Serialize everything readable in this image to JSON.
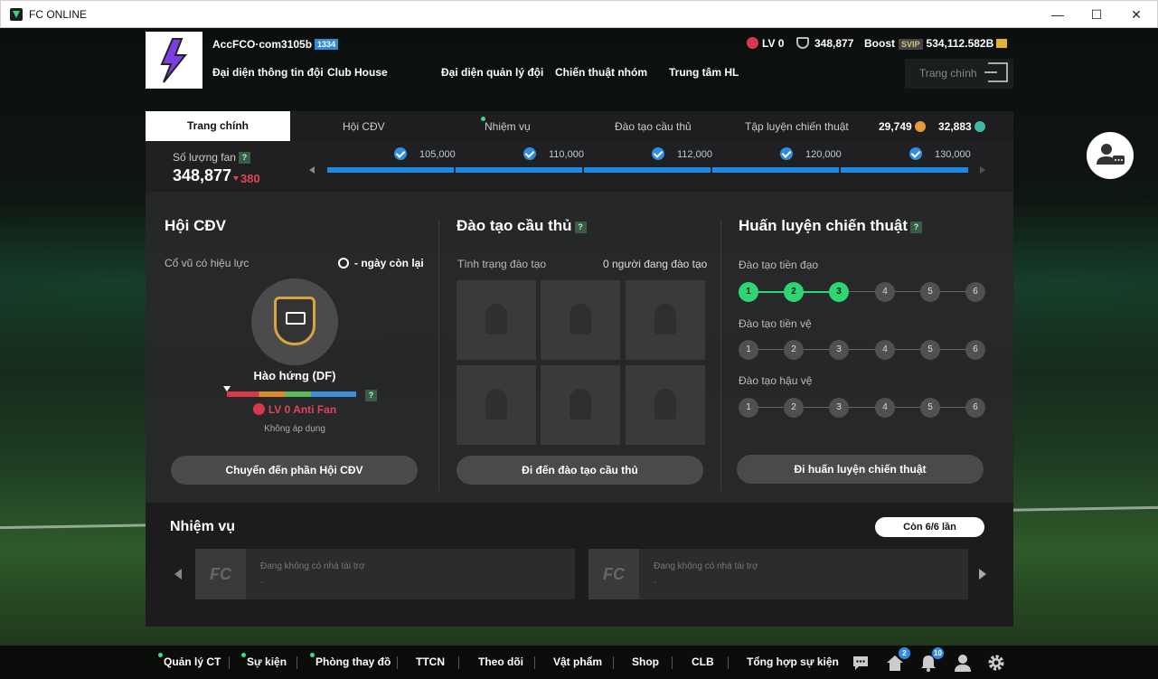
{
  "window": {
    "title": "FC ONLINE"
  },
  "header": {
    "username": "AccFCO·com3105b",
    "user_badge": "1334",
    "nav": [
      "Đại diện thông tin đội",
      "Club House",
      "Đại diện quản lý đội",
      "Chiến thuật nhóm",
      "Trung tâm HL"
    ],
    "level": "LV 0",
    "fans": "348,877",
    "boost_label": "Boost",
    "svip": "SVIP",
    "bp": "534,112.582B",
    "home_label": "Trang chính"
  },
  "tabs": {
    "active": "Trang chính",
    "items": [
      "Hội CĐV",
      "Nhiệm vụ",
      "Đào tạo cầu thủ",
      "Tập luyện chiến thuật"
    ],
    "coin1": "29,749",
    "coin2": "32,883"
  },
  "fan": {
    "label": "Số lượng fan",
    "count": "348,877",
    "delta": "380",
    "milestones": [
      "105,000",
      "110,000",
      "112,000",
      "120,000",
      "130,000"
    ]
  },
  "fanclub": {
    "title": "Hội CĐV",
    "effect_label": "Cổ vũ có hiệu lực",
    "days_left": "- ngày còn lại",
    "mood": "Hào hứng (DF)",
    "antifan": "LV 0 Anti Fan",
    "not_applied": "Không áp dụng",
    "button": "Chuyển đến phần Hội CĐV"
  },
  "training": {
    "title": "Đào tạo cầu thủ",
    "status_label": "Tình trạng đào tạo",
    "status_value": "0 người đang đào tạo",
    "button": "Đi đến đào tạo cầu thủ"
  },
  "tactics": {
    "title": "Huấn luyện chiến thuật",
    "rows": [
      {
        "label": "Đào tạo tiền đạo",
        "unlocked": 3
      },
      {
        "label": "Đào tạo tiền vệ",
        "unlocked": 0
      },
      {
        "label": "Đào tạo hậu vệ",
        "unlocked": 0
      }
    ],
    "nodes": [
      "1",
      "2",
      "3",
      "4",
      "5",
      "6"
    ],
    "button": "Đi huấn luyện chiến thuật"
  },
  "missions": {
    "title": "Nhiệm vụ",
    "remaining": "Còn 6/6 lần",
    "cards": [
      {
        "text": "Đang không có nhà tài trợ",
        "sub": "-"
      },
      {
        "text": "Đang không có nhà tài trợ",
        "sub": "-"
      }
    ]
  },
  "bottom_nav": [
    "Quản lý CT",
    "Sự kiện",
    "Phòng thay đồ",
    "TTCN",
    "Theo dõi",
    "Vật phẩm",
    "Shop",
    "CLB",
    "Tổng hợp sự kiện"
  ],
  "badges": {
    "home": "2",
    "bell": "10"
  },
  "colors": {
    "accent": "#1e88e5",
    "green": "#2ed573",
    "red": "#e0455a"
  }
}
